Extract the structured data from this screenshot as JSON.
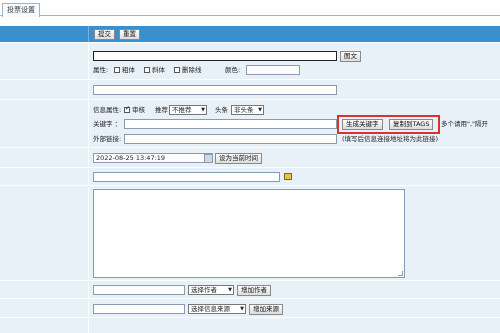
{
  "tab": {
    "label": "投票设置"
  },
  "toolbar": {
    "submit_label": "提交",
    "reset_label": "重置"
  },
  "title_row": {
    "preview_label": "图文"
  },
  "attr_row": {
    "attr_label": "属性:",
    "bold_label": "粗体",
    "italic_label": "斜体",
    "strike_label": "删除线",
    "color_label": "颜色:"
  },
  "info_row": {
    "info_attr_label": "信息属性:",
    "audit_label": "审核",
    "recommend_label": "推荐",
    "recommend_value": "不推荐",
    "headline_label": "头条",
    "headline_value": "非头条"
  },
  "keyword_row": {
    "label": "关键字 ：",
    "gen_button": "生成关键字",
    "copy_button": "复制到TAGS",
    "hint": "多个请用\",\"隔开"
  },
  "external_row": {
    "label": "外部链接:",
    "hint": "(填写后信息连接地址将为此链接)"
  },
  "time_row": {
    "value": "2022-08-25 13:47:19",
    "set_now_button": "设为当前时间"
  },
  "author_row": {
    "select_value": "选择作者",
    "add_button": "增加作者"
  },
  "source_row": {
    "select_value": "选择信息来源",
    "add_button": "增加来源"
  },
  "colors": {
    "header": "#3a90cf",
    "form_bg": "#e8f0f8",
    "highlight": "#d9342b"
  }
}
